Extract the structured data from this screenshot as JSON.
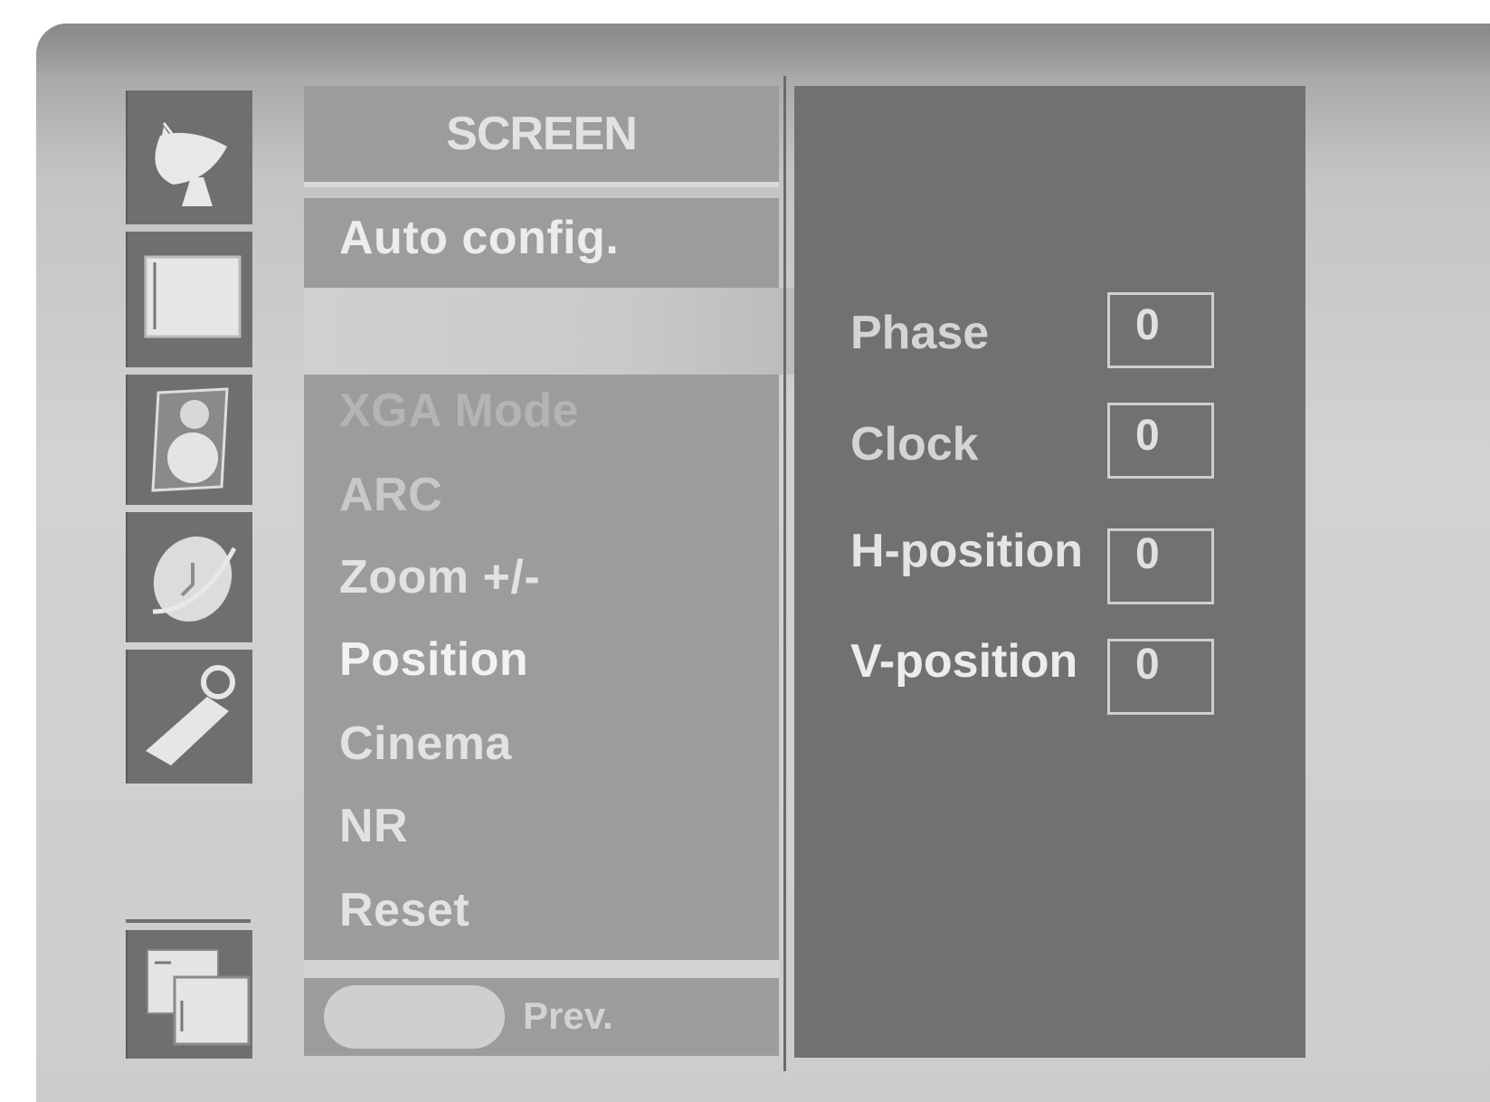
{
  "menu": {
    "title": "SCREEN",
    "items": [
      {
        "label": "Auto config.",
        "color": "#ececec"
      },
      {
        "label": "XGA Mode",
        "color": "#b4b4b4"
      },
      {
        "label": "ARC",
        "color": "#c8c8c8"
      },
      {
        "label": "Zoom +/-",
        "color": "#e2e2e2"
      },
      {
        "label": "Position",
        "color": "#f2f2f2"
      },
      {
        "label": "Cinema",
        "color": "#e2e2e2"
      },
      {
        "label": "NR",
        "color": "#e2e2e2"
      },
      {
        "label": "Reset",
        "color": "#e2e2e2"
      }
    ],
    "footer_label": "Prev."
  },
  "sidebar": {
    "icons": [
      "satellite-dish-icon",
      "screen-icon",
      "speaker-icon",
      "clock-icon",
      "key-icon",
      "pip-icon"
    ]
  },
  "position_panel": {
    "params": [
      {
        "label": "Phase",
        "value": "0"
      },
      {
        "label": "Clock",
        "value": "0"
      },
      {
        "label": "H-position",
        "value": "0"
      },
      {
        "label": "V-position",
        "value": "0"
      }
    ]
  }
}
